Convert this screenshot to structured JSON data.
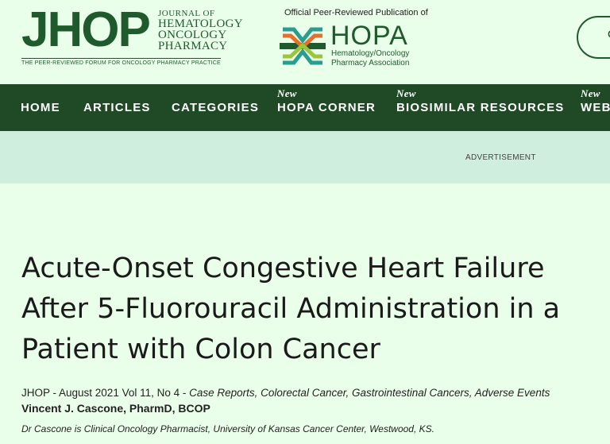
{
  "header": {
    "jhop_logo_text": "JHOP",
    "journal_line1": "JOURNAL OF",
    "journal_line2": "HEMATOLOGY",
    "journal_line3": "ONCOLOGY",
    "journal_line4": "PHARMACY",
    "tagline": "THE PEER-REVIEWED FORUM FOR ONCOLOGY PHARMACY PRACTICE",
    "official_text": "Official Peer-Reviewed Publication of",
    "hopa_word": "HOPA",
    "hopa_sub1": "Hematology/Oncology",
    "hopa_sub2": "Pharmacy Association",
    "search_icon": "search-icon"
  },
  "nav": {
    "items": [
      {
        "label": "HOME"
      },
      {
        "label": "ARTICLES"
      },
      {
        "label": "CATEGORIES"
      },
      {
        "label": "HOPA CORNER",
        "badge": "New"
      },
      {
        "label": "BIOSIMILAR RESOURCES",
        "badge": "New"
      },
      {
        "label": "WEB",
        "badge": "New"
      }
    ]
  },
  "ad": {
    "label": "ADVERTISEMENT"
  },
  "article": {
    "title": "Acute-Onset Congestive Heart Failure After 5-Fluorouracil Administration in a Patient with Colon Cancer",
    "issue": "JHOP - August 2021 Vol 11, No 4 - ",
    "categories": "Case Reports, Colorectal Cancer, Gastrointestinal Cancers, Adverse Events",
    "author": "Vincent J. Cascone, PharmD, BCOP",
    "affiliation": "Dr Cascone is Clinical Oncology Pharmacist, University of Kansas Cancer Center, Westwood, KS."
  },
  "colors": {
    "background": "#eaffea",
    "nav": "#1f4a25",
    "brand_green": "#1f5a2c",
    "ad_strip": "#cfeedd"
  }
}
